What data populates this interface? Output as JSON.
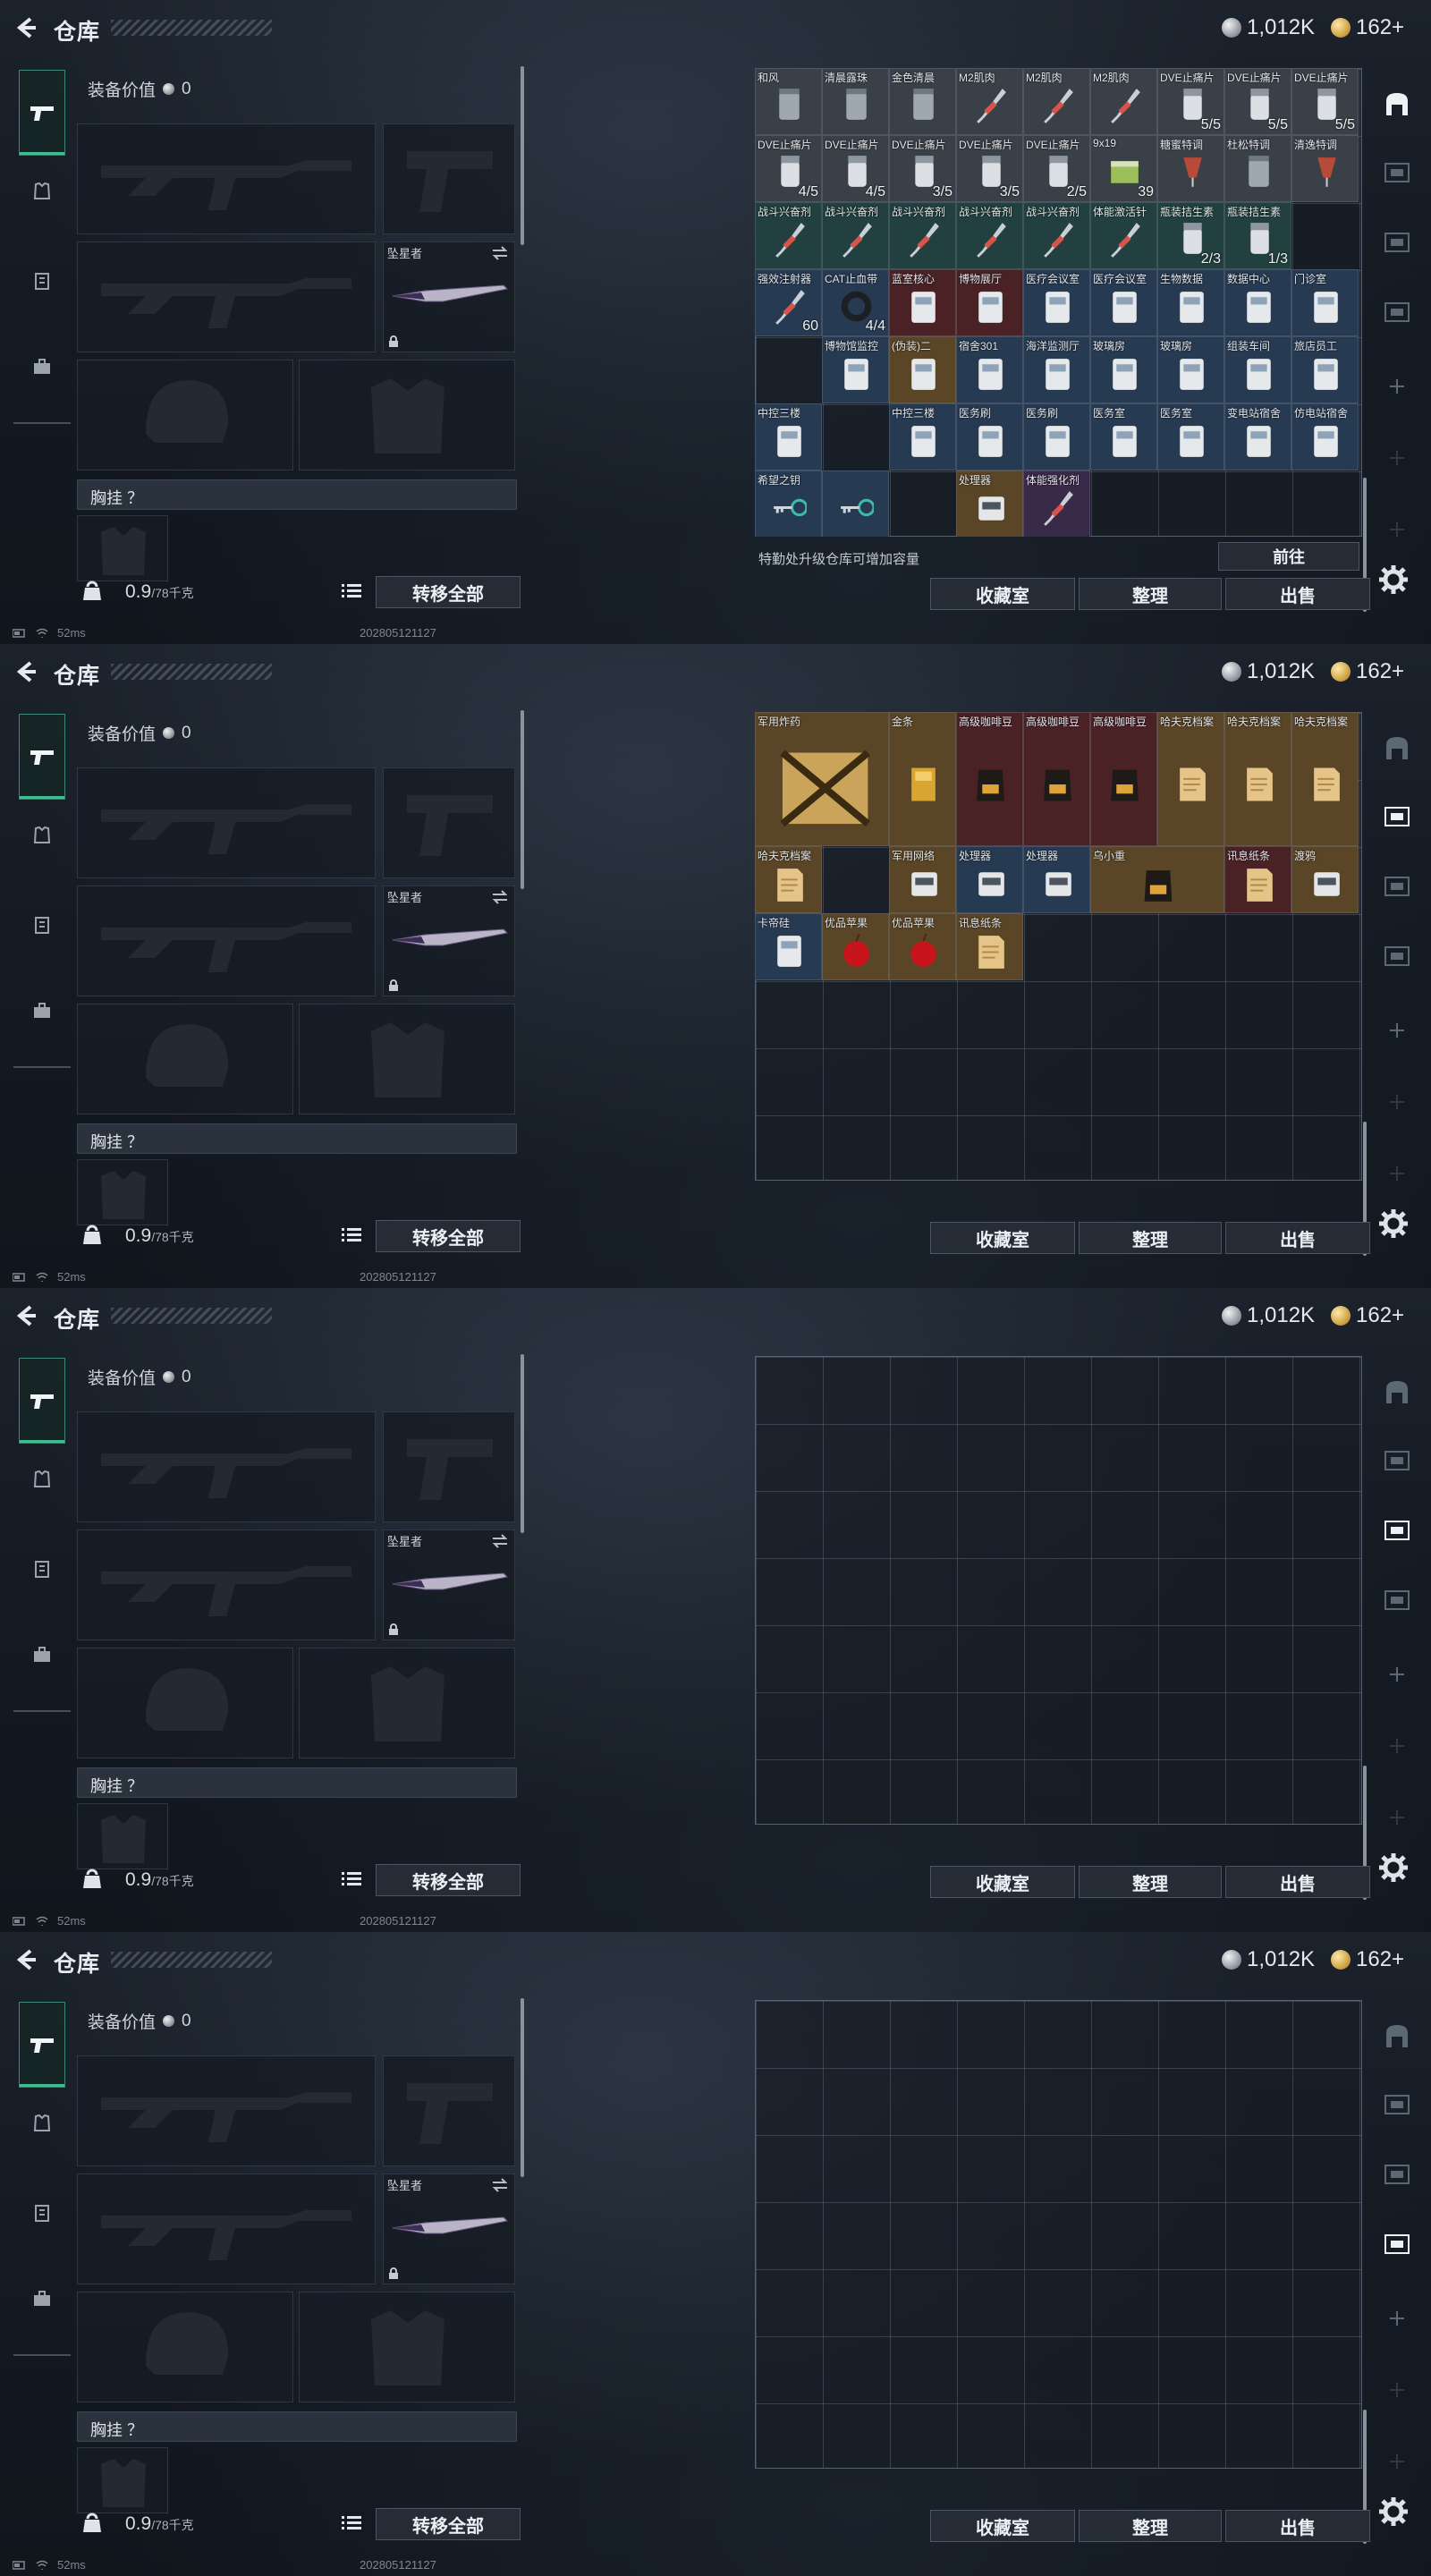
{
  "header": {
    "title": "仓库",
    "silver": "1,012K",
    "gold": "162+"
  },
  "equipment": {
    "value_label": "装备价值",
    "value": "0",
    "melee_label": "坠星者",
    "chest_label": "胸挂 ？",
    "weight": "0.9",
    "weight_max": "/78千克",
    "transfer_label": "转移全部"
  },
  "status": {
    "ping": "52ms",
    "version": "202805121127"
  },
  "stash": {
    "upgrade_note": "特勤处升级仓库可增加容量",
    "goto_label": "前往",
    "collect_label": "收藏室",
    "sort_label": "整理",
    "sell_label": "出售"
  },
  "panels": [
    {
      "items": [
        {
          "n": "和风",
          "c": "",
          "bg": "bg-grey",
          "a": "jar"
        },
        {
          "n": "清晨露珠",
          "c": "",
          "bg": "bg-grey",
          "a": "jar"
        },
        {
          "n": "金色清晨",
          "c": "",
          "bg": "bg-grey",
          "a": "jar"
        },
        {
          "n": "M2肌肉",
          "c": "",
          "bg": "bg-grey",
          "a": "syr"
        },
        {
          "n": "M2肌肉",
          "c": "",
          "bg": "bg-grey",
          "a": "syr"
        },
        {
          "n": "M2肌肉",
          "c": "",
          "bg": "bg-grey",
          "a": "syr"
        },
        {
          "n": "DVE止痛片",
          "c": "5/5",
          "bg": "bg-grey",
          "a": "pill"
        },
        {
          "n": "DVE止痛片",
          "c": "5/5",
          "bg": "bg-grey",
          "a": "pill"
        },
        {
          "n": "DVE止痛片",
          "c": "5/5",
          "bg": "bg-grey",
          "a": "pill"
        },
        {
          "n": "DVE止痛片",
          "c": "4/5",
          "bg": "bg-grey",
          "a": "pill"
        },
        {
          "n": "DVE止痛片",
          "c": "4/5",
          "bg": "bg-grey",
          "a": "pill"
        },
        {
          "n": "DVE止痛片",
          "c": "3/5",
          "bg": "bg-grey",
          "a": "pill"
        },
        {
          "n": "DVE止痛片",
          "c": "3/5",
          "bg": "bg-grey",
          "a": "pill"
        },
        {
          "n": "DVE止痛片",
          "c": "2/5",
          "bg": "bg-grey",
          "a": "pill"
        },
        {
          "n": "9x19",
          "c": "39",
          "bg": "bg-grey",
          "a": "ammo"
        },
        {
          "n": "糖蜜特调",
          "c": "",
          "bg": "bg-grey",
          "a": "drink"
        },
        {
          "n": "杜松特调",
          "c": "",
          "bg": "bg-grey",
          "a": "jar"
        },
        {
          "n": "清逸特调",
          "c": "",
          "bg": "bg-grey",
          "a": "drink"
        },
        {
          "n": "战斗兴奋剂",
          "c": "",
          "bg": "bg-teal",
          "a": "syr"
        },
        {
          "n": "战斗兴奋剂",
          "c": "",
          "bg": "bg-teal",
          "a": "syr"
        },
        {
          "n": "战斗兴奋剂",
          "c": "",
          "bg": "bg-teal",
          "a": "syr"
        },
        {
          "n": "战斗兴奋剂",
          "c": "",
          "bg": "bg-teal",
          "a": "syr"
        },
        {
          "n": "战斗兴奋剂",
          "c": "",
          "bg": "bg-teal",
          "a": "syr"
        },
        {
          "n": "体能激活针",
          "c": "",
          "bg": "bg-teal",
          "a": "syr"
        },
        {
          "n": "瓶装拮生素",
          "c": "2/3",
          "bg": "bg-teal",
          "a": "pill"
        },
        {
          "n": "瓶装拮生素",
          "c": "1/3",
          "bg": "bg-teal",
          "a": "pill"
        },
        {
          "n": "",
          "c": "",
          "bg": "bg-grey",
          "a": ""
        },
        {
          "n": "强效注射器",
          "c": "60",
          "bg": "bg-blue",
          "a": "syr"
        },
        {
          "n": "CAT止血带",
          "c": "4/4",
          "bg": "bg-blue",
          "a": "ring"
        },
        {
          "n": "蓝室核心",
          "c": "",
          "bg": "bg-red",
          "a": "card"
        },
        {
          "n": "博物展厅",
          "c": "",
          "bg": "bg-red",
          "a": "card"
        },
        {
          "n": "医疗会议室",
          "c": "",
          "bg": "bg-blue",
          "a": "card"
        },
        {
          "n": "医疗会议室",
          "c": "",
          "bg": "bg-blue",
          "a": "card"
        },
        {
          "n": "生物数据",
          "c": "",
          "bg": "bg-blue",
          "a": "card"
        },
        {
          "n": "数据中心",
          "c": "",
          "bg": "bg-blue",
          "a": "card"
        },
        {
          "n": "门诊室",
          "c": "",
          "bg": "bg-blue",
          "a": "card"
        },
        {
          "n": "",
          "c": "",
          "bg": "bg-grey",
          "a": ""
        },
        {
          "n": "博物馆监控",
          "c": "",
          "bg": "bg-blue",
          "a": "card"
        },
        {
          "n": "(伪装)二",
          "c": "",
          "bg": "bg-gold",
          "a": "card"
        },
        {
          "n": "宿舍301",
          "c": "",
          "bg": "bg-blue",
          "a": "card"
        },
        {
          "n": "海洋监测厅",
          "c": "",
          "bg": "bg-blue",
          "a": "card"
        },
        {
          "n": "玻璃房",
          "c": "",
          "bg": "bg-blue",
          "a": "card"
        },
        {
          "n": "玻璃房",
          "c": "",
          "bg": "bg-blue",
          "a": "card"
        },
        {
          "n": "组装车间",
          "c": "",
          "bg": "bg-blue",
          "a": "card"
        },
        {
          "n": "旅店员工",
          "c": "",
          "bg": "bg-blue",
          "a": "card"
        },
        {
          "n": "中控三楼",
          "c": "",
          "bg": "bg-blue",
          "a": "card"
        },
        {
          "n": "",
          "c": "",
          "bg": "bg-grey",
          "a": ""
        },
        {
          "n": "中控三楼",
          "c": "",
          "bg": "bg-blue",
          "a": "card"
        },
        {
          "n": "医务刷",
          "c": "",
          "bg": "bg-blue",
          "a": "card"
        },
        {
          "n": "医务刷",
          "c": "",
          "bg": "bg-blue",
          "a": "card"
        },
        {
          "n": "医务室",
          "c": "",
          "bg": "bg-blue",
          "a": "card"
        },
        {
          "n": "医务室",
          "c": "",
          "bg": "bg-blue",
          "a": "card"
        },
        {
          "n": "变电站宿舍",
          "c": "",
          "bg": "bg-blue",
          "a": "card"
        },
        {
          "n": "仿电站宿舍",
          "c": "",
          "bg": "bg-blue",
          "a": "card"
        },
        {
          "n": "希望之钥",
          "c": "",
          "bg": "bg-blue",
          "a": "key"
        },
        {
          "n": "",
          "c": "",
          "bg": "bg-blue",
          "a": "key"
        },
        {
          "n": "",
          "c": "",
          "bg": "bg-grey",
          "a": ""
        },
        {
          "n": "处理器",
          "c": "",
          "bg": "bg-gold",
          "a": "box"
        },
        {
          "n": "体能强化剂",
          "c": "",
          "bg": "bg-purple",
          "a": "syr"
        }
      ]
    },
    {
      "items": [
        {
          "n": "军用炸药",
          "c": "",
          "bg": "bg-gold",
          "a": "crate",
          "w": 2,
          "h": 2
        },
        {
          "n": "金条",
          "c": "",
          "bg": "bg-gold",
          "a": "gold",
          "w": 1,
          "h": 2
        },
        {
          "n": "高级咖啡豆",
          "c": "",
          "bg": "bg-red",
          "a": "bag",
          "w": 1,
          "h": 2
        },
        {
          "n": "高级咖啡豆",
          "c": "",
          "bg": "bg-red",
          "a": "bag",
          "w": 1,
          "h": 2
        },
        {
          "n": "高级咖啡豆",
          "c": "",
          "bg": "bg-red",
          "a": "bag",
          "w": 1,
          "h": 2
        },
        {
          "n": "哈夫克档案",
          "c": "",
          "bg": "bg-gold",
          "a": "paper",
          "w": 1,
          "h": 2
        },
        {
          "n": "哈夫克档案",
          "c": "",
          "bg": "bg-gold",
          "a": "paper",
          "w": 1,
          "h": 2
        },
        {
          "n": "哈夫克档案",
          "c": "",
          "bg": "bg-gold",
          "a": "paper",
          "w": 1,
          "h": 2
        },
        {
          "n": "哈夫克档案",
          "c": "",
          "bg": "bg-gold",
          "a": "paper",
          "w": 1,
          "h": 1
        },
        {
          "n": "",
          "c": "",
          "bg": "bg-gold",
          "a": "",
          "w": 1,
          "h": 1
        },
        {
          "n": "军用网络",
          "c": "",
          "bg": "bg-gold",
          "a": "box",
          "w": 1,
          "h": 1
        },
        {
          "n": "处理器",
          "c": "",
          "bg": "bg-blue",
          "a": "box",
          "w": 1,
          "h": 1
        },
        {
          "n": "处理器",
          "c": "",
          "bg": "bg-blue",
          "a": "box",
          "w": 1,
          "h": 1
        },
        {
          "n": "乌小重",
          "c": "",
          "bg": "bg-gold",
          "a": "bag",
          "w": 2,
          "h": 1
        },
        {
          "n": "讯息纸条",
          "c": "",
          "bg": "bg-red",
          "a": "paper",
          "w": 1,
          "h": 1
        },
        {
          "n": "渡鸦",
          "c": "",
          "bg": "bg-gold",
          "a": "box",
          "w": 1,
          "h": 1
        },
        {
          "n": "卡帝硅",
          "c": "",
          "bg": "bg-blue",
          "a": "card",
          "w": 1,
          "h": 1
        },
        {
          "n": "优品苹果",
          "c": "",
          "bg": "bg-gold",
          "a": "apple",
          "w": 1,
          "h": 1
        },
        {
          "n": "优品苹果",
          "c": "",
          "bg": "bg-gold",
          "a": "apple",
          "w": 1,
          "h": 1
        },
        {
          "n": "讯息纸条",
          "c": "",
          "bg": "bg-gold",
          "a": "paper",
          "w": 1,
          "h": 1
        }
      ]
    },
    {
      "items": []
    },
    {
      "items": []
    }
  ]
}
